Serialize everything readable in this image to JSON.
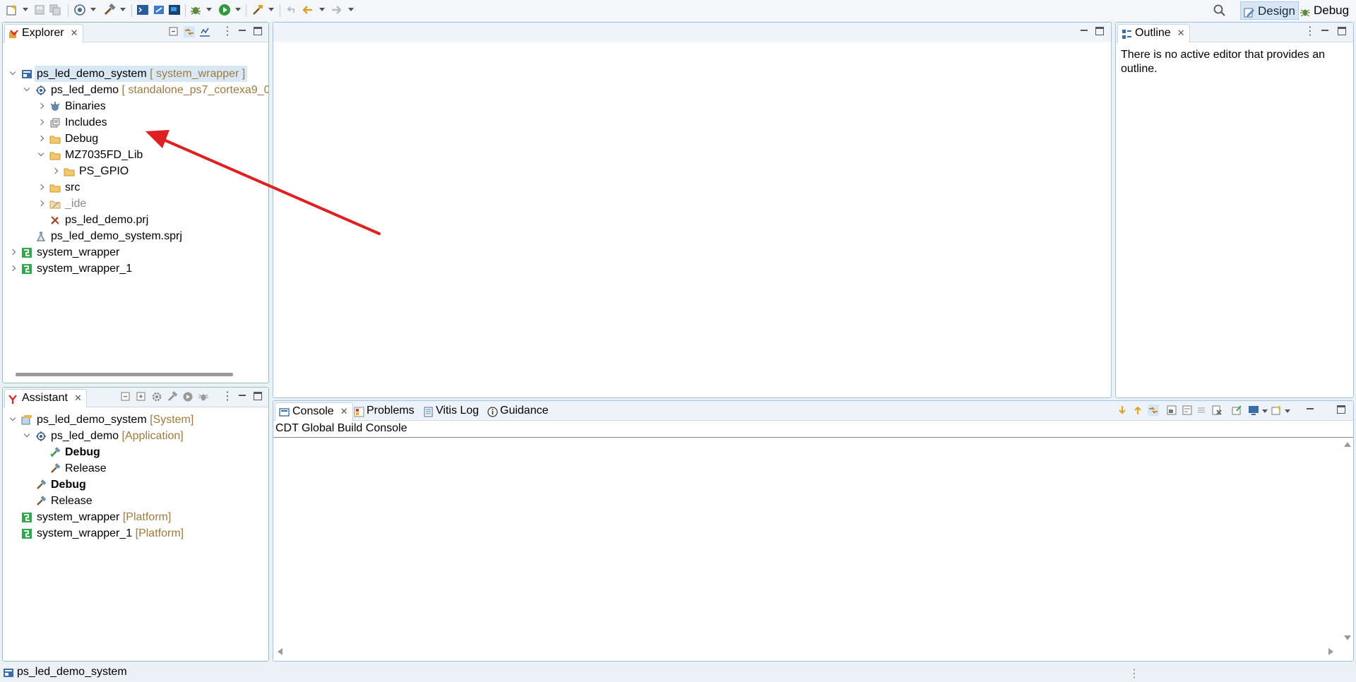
{
  "toolbar": {
    "perspectives": [
      {
        "label": "Design",
        "icon": "design-perspective-icon",
        "active": true
      },
      {
        "label": "Debug",
        "icon": "debug-perspective-icon",
        "active": false
      }
    ]
  },
  "explorer": {
    "tab_label": "Explorer",
    "tree": [
      {
        "label": "ps_led_demo_system",
        "decoration": "[ system_wrapper ]",
        "icon": "system-project-icon"
      },
      {
        "label": "ps_led_demo",
        "decoration": "[ standalone_ps7_cortexa9_0",
        "icon": "application-project-icon"
      },
      {
        "label": "Binaries",
        "icon": "binaries-icon"
      },
      {
        "label": "Includes",
        "icon": "includes-icon"
      },
      {
        "label": "Debug",
        "icon": "folder-icon"
      },
      {
        "label": "MZ7035FD_Lib",
        "icon": "folder-icon"
      },
      {
        "label": "PS_GPIO",
        "icon": "folder-icon"
      },
      {
        "label": "src",
        "icon": "folder-icon"
      },
      {
        "label": "_ide",
        "icon": "folder-icon"
      },
      {
        "label": "ps_led_demo.prj",
        "icon": "project-file-icon"
      },
      {
        "label": "ps_led_demo_system.sprj",
        "icon": "system-project-file-icon"
      },
      {
        "label": "system_wrapper",
        "icon": "platform-icon"
      },
      {
        "label": "system_wrapper_1",
        "icon": "platform-icon"
      }
    ]
  },
  "outline": {
    "tab_label": "Outline",
    "message_line1": "There is no active editor that provides an",
    "message_line2": "outline."
  },
  "assistant": {
    "tab_label": "Assistant",
    "tree": [
      {
        "label": "ps_led_demo_system",
        "decoration": "[System]"
      },
      {
        "label": "ps_led_demo",
        "decoration": "[Application]"
      },
      {
        "label": "Debug"
      },
      {
        "label": "Release"
      },
      {
        "label": "Debug"
      },
      {
        "label": "Release"
      },
      {
        "label": "system_wrapper",
        "decoration": "[Platform]"
      },
      {
        "label": "system_wrapper_1",
        "decoration": "[Platform]"
      }
    ]
  },
  "console": {
    "tabs": [
      {
        "label": "Console",
        "icon": "console-icon"
      },
      {
        "label": "Problems",
        "icon": "problems-icon"
      },
      {
        "label": "Vitis Log",
        "icon": "log-icon"
      },
      {
        "label": "Guidance",
        "icon": "info-icon"
      }
    ],
    "header": "CDT Global Build Console"
  },
  "statusbar": {
    "selection": "ps_led_demo_system"
  },
  "colors": {
    "panel_border": "#8fc6a9",
    "selection": "#d8e8f7",
    "decoration": "#a07a3e",
    "annotation_arrow": "#e02020"
  }
}
